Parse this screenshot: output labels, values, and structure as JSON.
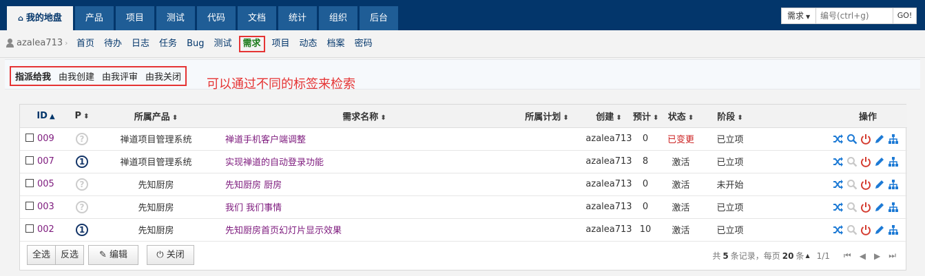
{
  "topnav": {
    "tabs": [
      {
        "label": "我的地盘",
        "icon": "home-icon",
        "active": true
      },
      {
        "label": "产品"
      },
      {
        "label": "项目"
      },
      {
        "label": "测试"
      },
      {
        "label": "代码"
      },
      {
        "label": "文档"
      },
      {
        "label": "统计"
      },
      {
        "label": "组织"
      },
      {
        "label": "后台"
      }
    ],
    "search": {
      "type_label": "需求",
      "placeholder": "编号(ctrl+g)",
      "go_label": "GO!"
    }
  },
  "submenu": {
    "user": "azalea713",
    "items": [
      "首页",
      "待办",
      "日志",
      "任务",
      "Bug",
      "测试",
      "需求",
      "项目",
      "动态",
      "档案",
      "密码"
    ],
    "active_index": 6
  },
  "filters": {
    "tabs": [
      "指派给我",
      "由我创建",
      "由我评审",
      "由我关闭"
    ],
    "active_index": 0,
    "annotation": "可以通过不同的标签来检索"
  },
  "table": {
    "headers": {
      "id": "ID",
      "pri": "P",
      "product": "所属产品",
      "title": "需求名称",
      "plan": "所属计划",
      "creator": "创建",
      "estimate": "预计",
      "status": "状态",
      "stage": "阶段",
      "actions": "操作"
    },
    "rows": [
      {
        "id": "009",
        "pri": "?",
        "product": "禅道项目管理系统",
        "title": "禅道手机客户端调整",
        "plan": "",
        "creator": "azalea713",
        "estimate": "0",
        "status": "已变更",
        "stage": "已立项"
      },
      {
        "id": "007",
        "pri": "1",
        "product": "禅道项目管理系统",
        "title": "实现禅道的自动登录功能",
        "plan": "",
        "creator": "azalea713",
        "estimate": "8",
        "status": "激活",
        "stage": "已立项"
      },
      {
        "id": "005",
        "pri": "?",
        "product": "先知厨房",
        "title": "先知厨房 厨房",
        "plan": "",
        "creator": "azalea713",
        "estimate": "0",
        "status": "激活",
        "stage": "未开始"
      },
      {
        "id": "003",
        "pri": "?",
        "product": "先知厨房",
        "title": "我们 我们事情",
        "plan": "",
        "creator": "azalea713",
        "estimate": "0",
        "status": "激活",
        "stage": "已立项"
      },
      {
        "id": "002",
        "pri": "1",
        "product": "先知厨房",
        "title": "先知厨房首页幻灯片显示效果",
        "plan": "",
        "creator": "azalea713",
        "estimate": "10",
        "status": "激活",
        "stage": "已立项"
      }
    ]
  },
  "footer": {
    "select_all": "全选",
    "invert": "反选",
    "edit": "编辑",
    "close": "关闭",
    "pager": {
      "prefix": "共",
      "total": "5",
      "mid": "条记录，每页",
      "per_page": "20",
      "suffix": "条",
      "page": "1/1"
    }
  },
  "colors": {
    "nav_bg": "#03366b",
    "tab_bg": "#1f5d96",
    "highlight": "#e53333",
    "link": "#7d1a7d",
    "changed_status": "#c22222"
  }
}
